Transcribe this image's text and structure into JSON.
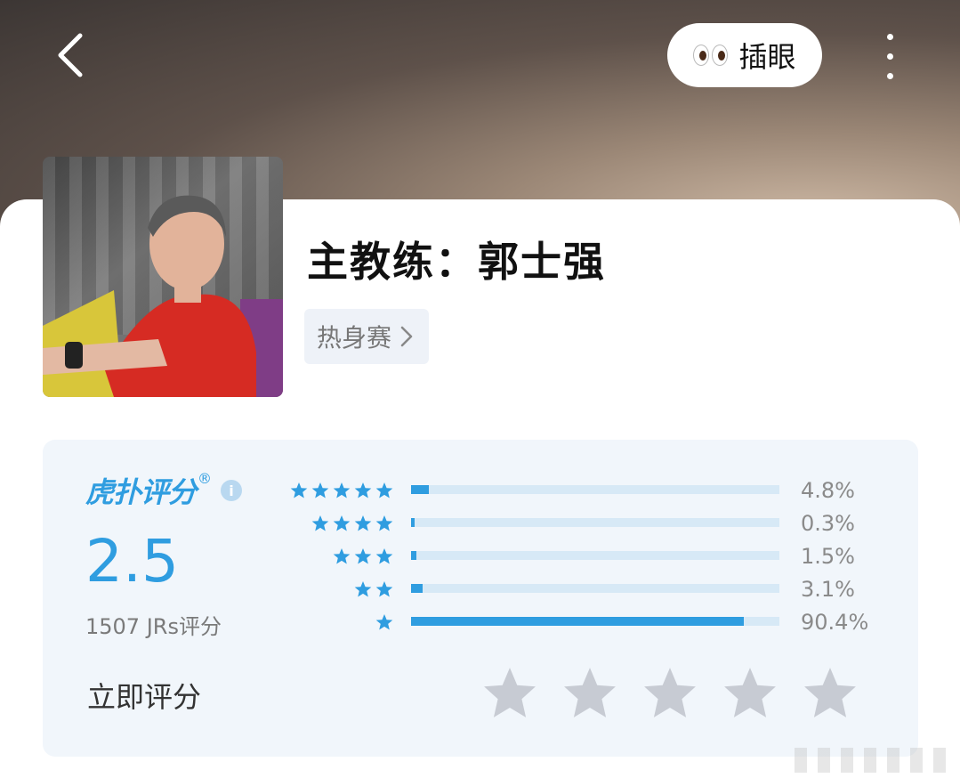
{
  "header": {
    "back_icon": "back-chevron-icon",
    "peek_label": "插眼",
    "peek_icon": "eyes-emoji-icon",
    "more_icon": "more-vertical-icon"
  },
  "profile": {
    "title": "主教练：郭士强",
    "tag": "热身赛",
    "tag_icon": "chevron-right-icon"
  },
  "rating": {
    "brand": "虎扑评分",
    "brand_reg": "®",
    "info_icon": "i",
    "score": "2.5",
    "votes": "1507 JRs评分",
    "rate_now": "立即评分",
    "accent_color": "#2f9de0",
    "distribution": [
      {
        "stars": 5,
        "percent": 4.8,
        "label": "4.8%"
      },
      {
        "stars": 4,
        "percent": 0.3,
        "label": "0.3%"
      },
      {
        "stars": 3,
        "percent": 1.5,
        "label": "1.5%"
      },
      {
        "stars": 2,
        "percent": 3.1,
        "label": "3.1%"
      },
      {
        "stars": 1,
        "percent": 90.4,
        "label": "90.4%"
      }
    ],
    "user_rating": 0,
    "user_rating_max": 5
  }
}
